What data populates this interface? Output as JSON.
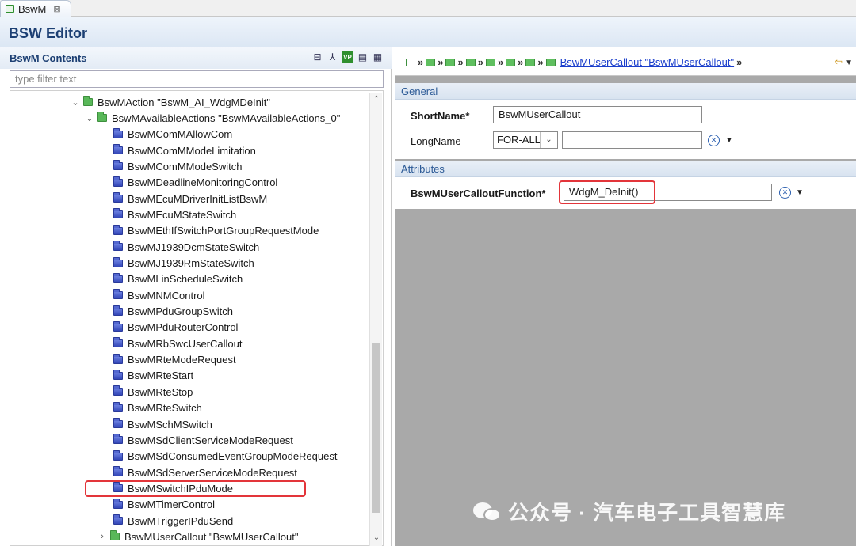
{
  "tab": {
    "label": "BswM",
    "close": "⊠"
  },
  "editor": {
    "title": "BSW Editor"
  },
  "contents": {
    "title": "BswM Contents",
    "filter_placeholder": "type filter text",
    "tools": [
      "collapse-all-icon",
      "hierarchy-icon",
      "vp-icon",
      "document-icon",
      "table-icon"
    ]
  },
  "tree": {
    "items": [
      {
        "label": "BswMAction \"BswM_AI_WdgMDeInit\"",
        "type": "green",
        "expanded": true
      },
      {
        "label": "BswMAvailableActions \"BswMAvailableActions_0\"",
        "type": "green",
        "expanded": true
      },
      {
        "label": "BswMComMAllowCom",
        "type": "blue"
      },
      {
        "label": "BswMComMModeLimitation",
        "type": "blue"
      },
      {
        "label": "BswMComMModeSwitch",
        "type": "blue"
      },
      {
        "label": "BswMDeadlineMonitoringControl",
        "type": "blue"
      },
      {
        "label": "BswMEcuMDriverInitListBswM",
        "type": "blue"
      },
      {
        "label": "BswMEcuMStateSwitch",
        "type": "blue"
      },
      {
        "label": "BswMEthIfSwitchPortGroupRequestMode",
        "type": "blue"
      },
      {
        "label": "BswMJ1939DcmStateSwitch",
        "type": "blue"
      },
      {
        "label": "BswMJ1939RmStateSwitch",
        "type": "blue"
      },
      {
        "label": "BswMLinScheduleSwitch",
        "type": "blue"
      },
      {
        "label": "BswMNMControl",
        "type": "blue"
      },
      {
        "label": "BswMPduGroupSwitch",
        "type": "blue"
      },
      {
        "label": "BswMPduRouterControl",
        "type": "blue"
      },
      {
        "label": "BswMRbSwcUserCallout",
        "type": "blue"
      },
      {
        "label": "BswMRteModeRequest",
        "type": "blue"
      },
      {
        "label": "BswMRteStart",
        "type": "blue"
      },
      {
        "label": "BswMRteStop",
        "type": "blue"
      },
      {
        "label": "BswMRteSwitch",
        "type": "blue"
      },
      {
        "label": "BswMSchMSwitch",
        "type": "blue"
      },
      {
        "label": "BswMSdClientServiceModeRequest",
        "type": "blue"
      },
      {
        "label": "BswMSdConsumedEventGroupModeRequest",
        "type": "blue"
      },
      {
        "label": "BswMSdServerServiceModeRequest",
        "type": "blue"
      },
      {
        "label": "BswMSwitchIPduMode",
        "type": "blue"
      },
      {
        "label": "BswMTimerControl",
        "type": "blue"
      },
      {
        "label": "BswMTriggerIPduSend",
        "type": "blue"
      },
      {
        "label": "BswMUserCallout \"BswMUserCallout\"",
        "type": "green",
        "expanded": false,
        "selected": true
      }
    ]
  },
  "breadcrumb": {
    "link": "BswMUserCallout \"BswMUserCallout\""
  },
  "general": {
    "heading": "General",
    "shortname_label": "ShortName*",
    "shortname_value": "BswMUserCallout",
    "longname_label": "LongName",
    "longname_lang": "FOR-ALL",
    "longname_value": ""
  },
  "attributes": {
    "heading": "Attributes",
    "callout_label": "BswMUserCalloutFunction*",
    "callout_value": "WdgM_DeInit()"
  },
  "watermark": {
    "text": "公众号 · 汽车电子工具智慧库"
  },
  "colors": {
    "highlight": "#e3353a",
    "accent": "#1c3f73",
    "link": "#1a3ecc"
  }
}
